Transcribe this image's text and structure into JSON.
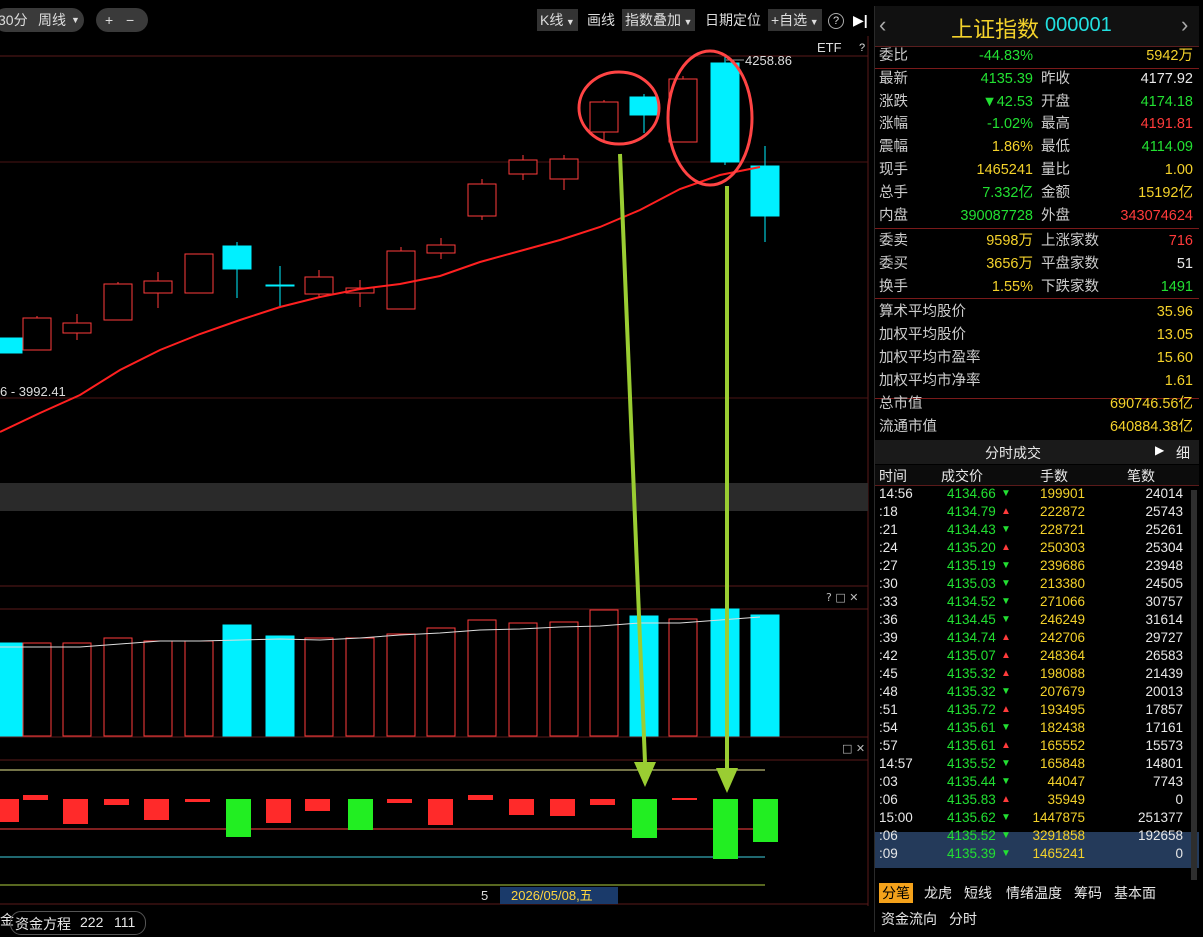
{
  "toolbar": {
    "period_30": "30分",
    "period_week": "周线",
    "plus": "+",
    "minus": "−",
    "kline": "K线",
    "draw": "画线",
    "overlay": "指数叠加",
    "date_locate": "日期定位",
    "watchlist": "+自选",
    "help": "?",
    "etf": "ETF",
    "small_help": "?"
  },
  "chart": {
    "high_label": "4258.86",
    "low_label": "6 - 3992.41",
    "date_cursor": "2026/05/08,五",
    "axis_number": "5",
    "vol_controls": "? □ ✕",
    "macd_controls": "□ ✕",
    "colors": {
      "up": "#ff3b3b",
      "down": "#00f0ff",
      "ma": "#ff2020",
      "annot_circle": "#ff4444",
      "annot_arrow": "#9acd32"
    }
  },
  "bottom_tabs": [
    "资金方程",
    "222",
    "111"
  ],
  "bottom_left_partial": "金",
  "panel": {
    "name": "上证指数",
    "code": "000001",
    "quote": [
      {
        "l1": "委比",
        "v1": "-44.83%",
        "c1": "grn",
        "l2": "",
        "v2": "5942万",
        "c2": "yel"
      },
      {
        "l1": "最新",
        "v1": "4135.39",
        "c1": "grn",
        "l2": "昨收",
        "v2": "4177.92",
        "c2": "wht"
      },
      {
        "l1": "涨跌",
        "v1": "▼42.53",
        "c1": "grn",
        "l2": "开盘",
        "v2": "4174.18",
        "c2": "grn"
      },
      {
        "l1": "涨幅",
        "v1": "-1.02%",
        "c1": "grn",
        "l2": "最高",
        "v2": "4191.81",
        "c2": "red"
      },
      {
        "l1": "震幅",
        "v1": "1.86%",
        "c1": "yel",
        "l2": "最低",
        "v2": "4114.09",
        "c2": "grn"
      },
      {
        "l1": "现手",
        "v1": "1465241",
        "c1": "yel",
        "l2": "量比",
        "v2": "1.00",
        "c2": "yel"
      },
      {
        "l1": "总手",
        "v1": "7.332亿",
        "c1": "grn",
        "l2": "金额",
        "v2": "15192亿",
        "c2": "yel"
      },
      {
        "l1": "内盘",
        "v1": "390087728",
        "c1": "grn",
        "l2": "外盘",
        "v2": "343074624",
        "c2": "red"
      }
    ],
    "breadth": [
      {
        "l1": "委卖",
        "v1": "9598万",
        "c1": "yel",
        "l2": "上涨家数",
        "v2": "716",
        "c2": "red"
      },
      {
        "l1": "委买",
        "v1": "3656万",
        "c1": "yel",
        "l2": "平盘家数",
        "v2": "51",
        "c2": "wht"
      },
      {
        "l1": "换手",
        "v1": "1.55%",
        "c1": "yel",
        "l2": "下跌家数",
        "v2": "1491",
        "c2": "grn"
      }
    ],
    "stats": [
      {
        "label": "算术平均股价",
        "value": "35.96"
      },
      {
        "label": "加权平均股价",
        "value": "13.05"
      },
      {
        "label": "加权平均市盈率",
        "value": "15.60"
      },
      {
        "label": "加权平均市净率",
        "value": "1.61"
      },
      {
        "label": "总市值",
        "value": "690746.56亿"
      },
      {
        "label": "流通市值",
        "value": "640884.38亿"
      }
    ],
    "ticks_title": "分时成交",
    "ticks_detail": "细",
    "ticks_headers": [
      "时间",
      "成交价",
      "手数",
      "笔数"
    ],
    "ticks": [
      {
        "t": "14:56",
        "p": "4134.66",
        "d": "down",
        "v": "199901",
        "n": "24014"
      },
      {
        "t": ":18",
        "p": "4134.79",
        "d": "up",
        "v": "222872",
        "n": "25743"
      },
      {
        "t": ":21",
        "p": "4134.43",
        "d": "down",
        "v": "228721",
        "n": "25261"
      },
      {
        "t": ":24",
        "p": "4135.20",
        "d": "up",
        "v": "250303",
        "n": "25304"
      },
      {
        "t": ":27",
        "p": "4135.19",
        "d": "down",
        "v": "239686",
        "n": "23948"
      },
      {
        "t": ":30",
        "p": "4135.03",
        "d": "down",
        "v": "213380",
        "n": "24505"
      },
      {
        "t": ":33",
        "p": "4134.52",
        "d": "down",
        "v": "271066",
        "n": "30757"
      },
      {
        "t": ":36",
        "p": "4134.45",
        "d": "down",
        "v": "246249",
        "n": "31614"
      },
      {
        "t": ":39",
        "p": "4134.74",
        "d": "up",
        "v": "242706",
        "n": "29727"
      },
      {
        "t": ":42",
        "p": "4135.07",
        "d": "up",
        "v": "248364",
        "n": "26583"
      },
      {
        "t": ":45",
        "p": "4135.32",
        "d": "up",
        "v": "198088",
        "n": "21439"
      },
      {
        "t": ":48",
        "p": "4135.32",
        "d": "down",
        "v": "207679",
        "n": "20013"
      },
      {
        "t": ":51",
        "p": "4135.72",
        "d": "up",
        "v": "193495",
        "n": "17857"
      },
      {
        "t": ":54",
        "p": "4135.61",
        "d": "down",
        "v": "182438",
        "n": "17161"
      },
      {
        "t": ":57",
        "p": "4135.61",
        "d": "up",
        "v": "165552",
        "n": "15573"
      },
      {
        "t": "14:57",
        "p": "4135.52",
        "d": "down",
        "v": "165848",
        "n": "14801"
      },
      {
        "t": ":03",
        "p": "4135.44",
        "d": "down",
        "v": "44047",
        "n": "7743"
      },
      {
        "t": ":06",
        "p": "4135.83",
        "d": "up",
        "v": "35949",
        "n": "0"
      },
      {
        "t": "15:00",
        "p": "4135.62",
        "d": "down",
        "v": "1447875",
        "n": "251377"
      },
      {
        "t": ":06",
        "p": "4135.52",
        "d": "down",
        "v": "3291858",
        "n": "192658"
      },
      {
        "t": ":09",
        "p": "4135.39",
        "d": "down",
        "v": "1465241",
        "n": "0"
      }
    ],
    "tabs_row1": [
      "分笔",
      "龙虎",
      "短线",
      "情绪温度",
      "筹码",
      "基本面"
    ],
    "tabs_row2": [
      "资金流向",
      "分时"
    ]
  }
}
